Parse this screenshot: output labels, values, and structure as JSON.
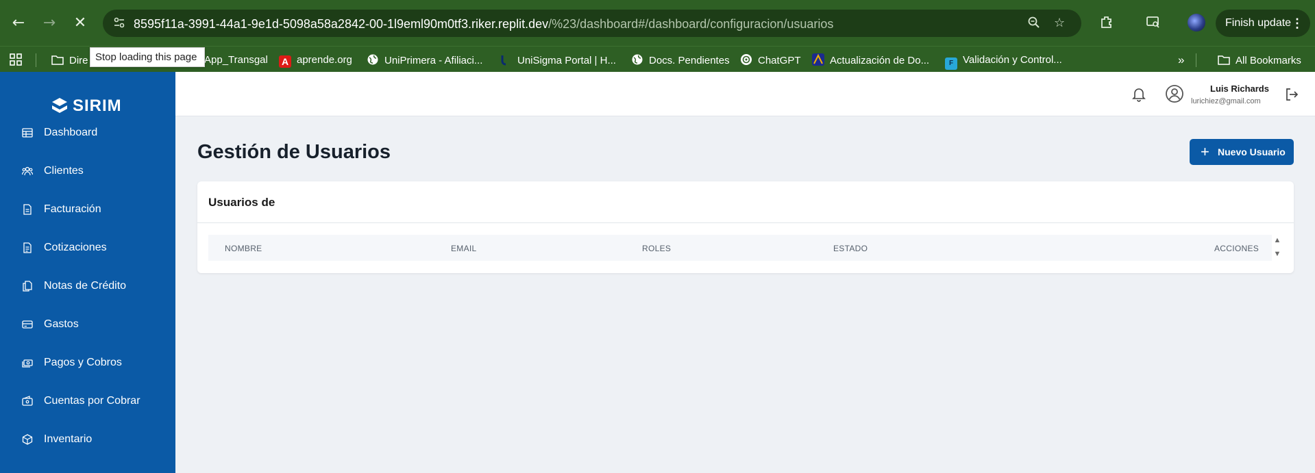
{
  "browser": {
    "url_main": "8595f11a-3991-44a1-9e1d-5098a58a2842-00-1l9eml90m0tf3.riker.replit.dev",
    "url_rest": "/%23/dashboard#/dashboard/configuracion/usuarios",
    "finish_update": "Finish update",
    "tooltip": "Stop loading this page",
    "bookmarks": [
      {
        "label": "Dire",
        "icon": "folder-icon"
      },
      {
        "label": "App_Transgal",
        "icon": "page-icon"
      },
      {
        "label": "aprende.org",
        "icon": "angular-icon",
        "color": "#dd1b16"
      },
      {
        "label": "UniPrimera - Afiliaci...",
        "icon": "globe-icon"
      },
      {
        "label": "UniSigma Portal | H...",
        "icon": "unisigma-icon",
        "color": "#0a2a6e"
      },
      {
        "label": "Docs. Pendientes",
        "icon": "globe-icon"
      },
      {
        "label": "ChatGPT",
        "icon": "openai-icon"
      },
      {
        "label": "Actualización de Do...",
        "icon": "app-icon",
        "color": "#1c2b8f"
      },
      {
        "label": "Validación y Control...",
        "icon": "powerapps-icon",
        "color": "#28a8d8"
      }
    ],
    "all_bookmarks": "All Bookmarks"
  },
  "sidebar": {
    "brand": "SIRIM",
    "items": [
      {
        "label": "Dashboard",
        "icon": "table-icon"
      },
      {
        "label": "Clientes",
        "icon": "users-icon"
      },
      {
        "label": "Facturación",
        "icon": "file-icon"
      },
      {
        "label": "Cotizaciones",
        "icon": "file-text-icon"
      },
      {
        "label": "Notas de Crédito",
        "icon": "copy-file-icon"
      },
      {
        "label": "Gastos",
        "icon": "credit-card-icon"
      },
      {
        "label": "Pagos y Cobros",
        "icon": "cash-icon"
      },
      {
        "label": "Cuentas por Cobrar",
        "icon": "wallet-icon"
      },
      {
        "label": "Inventario",
        "icon": "box-icon"
      }
    ]
  },
  "header": {
    "user_name": "Luis Richards",
    "user_email": "lurichiez@gmail.com"
  },
  "main": {
    "title": "Gestión de Usuarios",
    "new_button": "Nuevo Usuario",
    "card_title": "Usuarios de",
    "columns": [
      "NOMBRE",
      "EMAIL",
      "ROLES",
      "ESTADO",
      "ACCIONES"
    ]
  }
}
